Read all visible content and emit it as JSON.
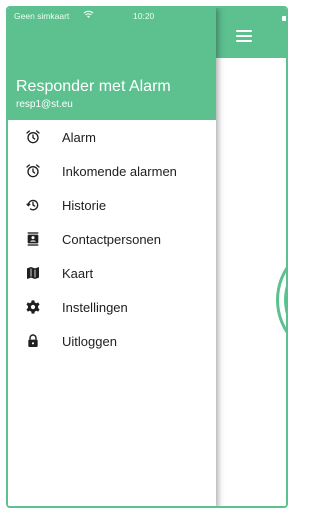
{
  "status_bar": {
    "carrier": "Geen simkaart",
    "time": "10:20"
  },
  "drawer": {
    "user_name": "Responder met Alarm",
    "user_email": "resp1@st.eu",
    "items": [
      {
        "label": "Alarm",
        "icon": "alarm-clock-icon"
      },
      {
        "label": "Inkomende alarmen",
        "icon": "alarm-clock-icon"
      },
      {
        "label": "Historie",
        "icon": "history-icon"
      },
      {
        "label": "Contactpersonen",
        "icon": "contacts-icon"
      },
      {
        "label": "Kaart",
        "icon": "map-icon"
      },
      {
        "label": "Instellingen",
        "icon": "gear-icon"
      },
      {
        "label": "Uitloggen",
        "icon": "lock-icon"
      }
    ]
  },
  "colors": {
    "accent": "#5cc08f",
    "text": "#202020",
    "background": "#ffffff"
  }
}
